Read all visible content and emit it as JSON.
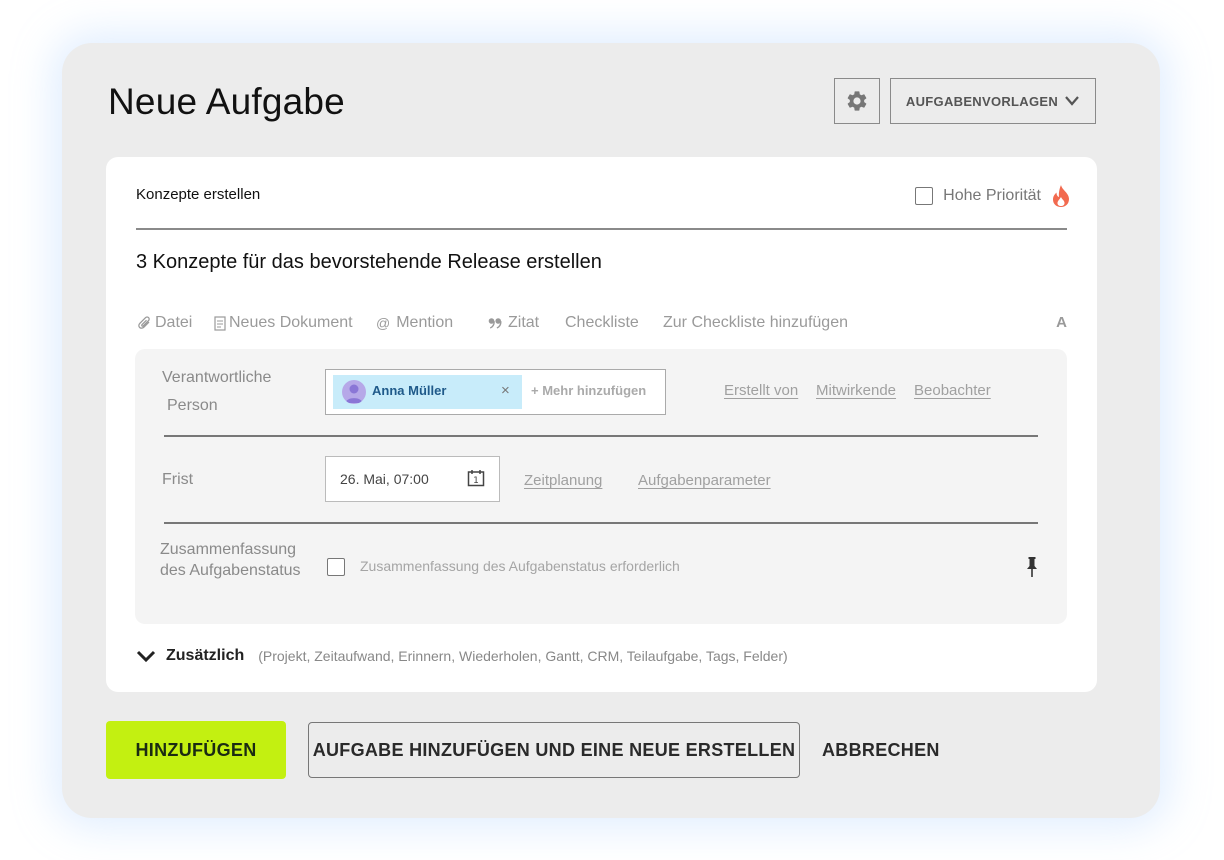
{
  "dialog": {
    "title": "Neue Aufgabe",
    "templates_label": "AUFGABENVORLAGEN"
  },
  "task": {
    "title": "Konzepte erstellen",
    "high_priority_label": "Hohe Priorität",
    "high_priority_checked": false,
    "description": "3 Konzepte für das bevorstehende Release erstellen"
  },
  "toolbar": {
    "file": "Datei",
    "new_document": "Neues Dokument",
    "mention": "Mention",
    "quote": "Zitat",
    "checklist": "Checkliste",
    "add_to_checklist": "Zur Checkliste hinzufügen",
    "format": "A"
  },
  "responsible": {
    "label_line1": "Verantwortliche",
    "label_line2": "Person",
    "assignee": "Anna Müller",
    "remove": "×",
    "add_more": "+ Mehr hinzufügen",
    "links": [
      "Erstellt von",
      "Mitwirkende",
      "Beobachter"
    ]
  },
  "deadline": {
    "label": "Frist",
    "value": "26. Mai, 07:00",
    "calendar_day": "1",
    "links": [
      "Zeitplanung",
      "Aufgabenparameter"
    ]
  },
  "summary": {
    "label_line1": "Zusammenfassung",
    "label_line2": "des Aufgabenstatus",
    "checkbox_label": "Zusammenfassung des Aufgabenstatus erforderlich",
    "checked": false
  },
  "additional": {
    "label": "Zusätzlich",
    "items": "(Projekt, Zeitaufwand, Erinnern, Wiederholen, Gantt, CRM, Teilaufgabe, Tags, Felder)"
  },
  "footer": {
    "add": "HINZUFÜGEN",
    "add_and_new": "AUFGABE HINZUFÜGEN UND EINE NEUE ERSTELLEN",
    "cancel": "ABBRECHEN"
  },
  "colors": {
    "primary_button": "#c3f011",
    "chip_background": "#c8ecfa",
    "fire_icon": "#f26a4f",
    "dialog_background": "#ececec"
  }
}
